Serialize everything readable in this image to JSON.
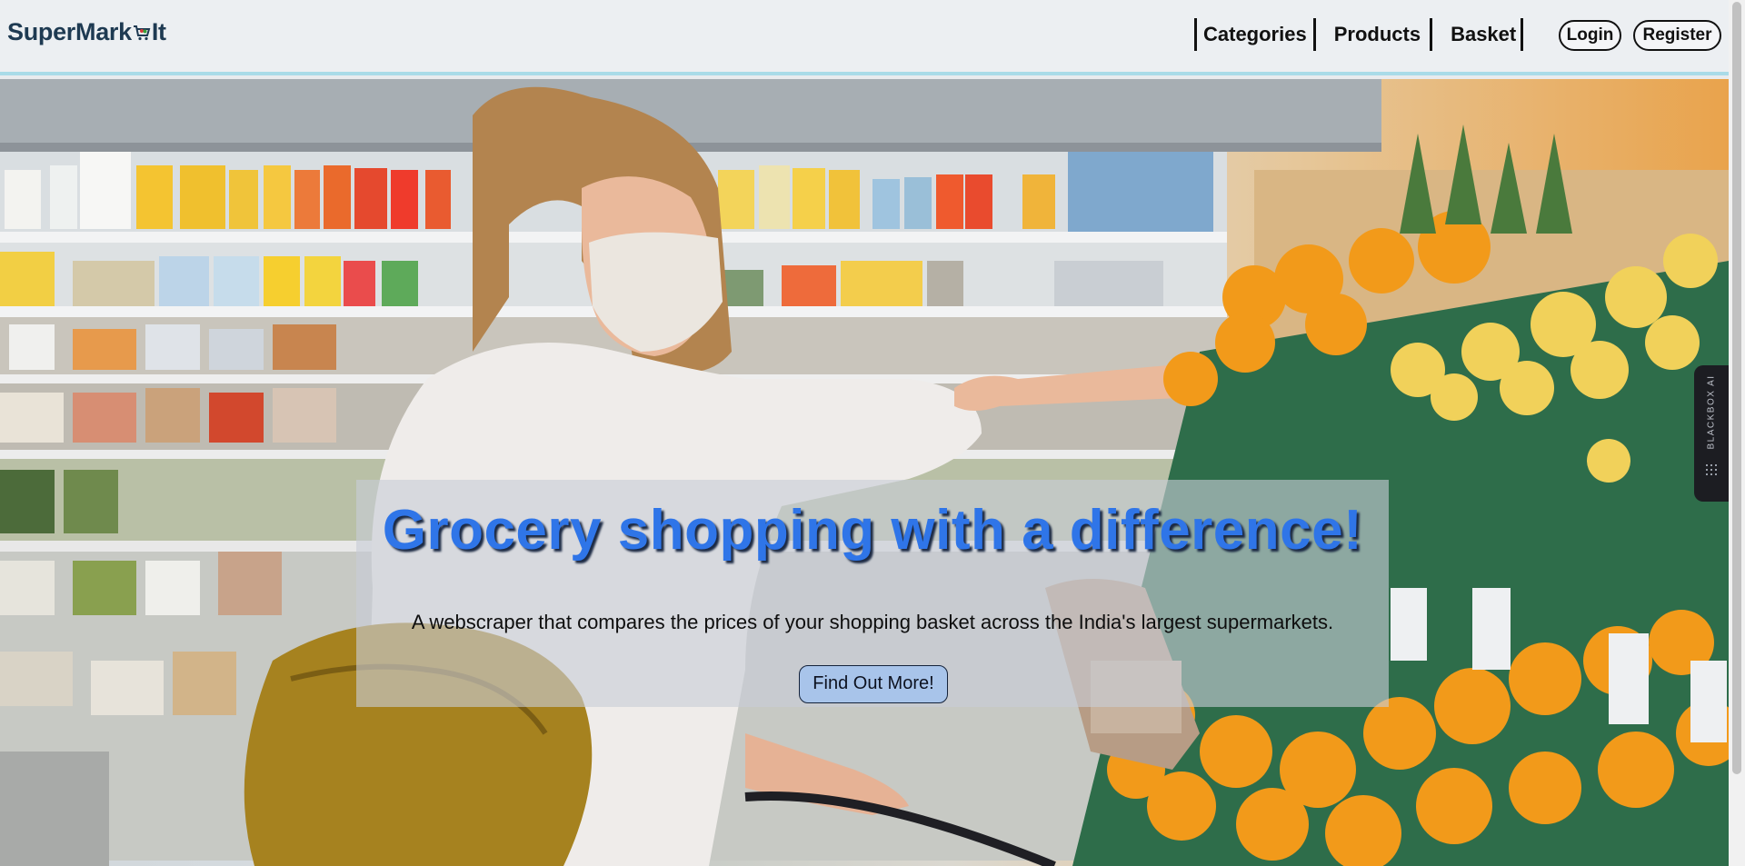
{
  "header": {
    "logo_text_before": "SuperMark",
    "logo_text_after": "It",
    "logo_icon": "shopping-cart-icon",
    "nav": [
      {
        "label": "Categories"
      },
      {
        "label": "Products"
      },
      {
        "label": "Basket"
      }
    ],
    "login_label": "Login",
    "register_label": "Register"
  },
  "hero": {
    "headline": "Grocery shopping with a difference!",
    "subline": "A webscraper that compares the prices of your shopping basket across the India's largest supermarkets.",
    "cta_label": "Find Out More!",
    "background": "supermarket-aisle-photo"
  },
  "side_widget": {
    "label": "BLACKBOX AI",
    "icon": "blackbox-icon"
  },
  "colors": {
    "headline": "#2f75e8",
    "header_border": "#a9dbe8",
    "cta_bg": "#a8c4ea"
  }
}
